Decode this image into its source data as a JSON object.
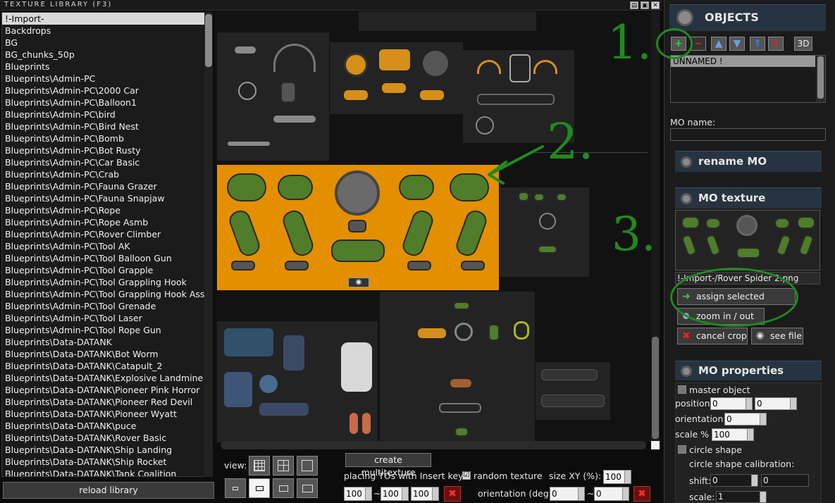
{
  "window": {
    "title": "TEXTURE LIBRARY (F3)"
  },
  "library": {
    "items": [
      "!-Import-",
      "Backdrops",
      "BG",
      "BG_chunks_50p",
      "Blueprints",
      "Blueprints\\Admin-PC",
      "Blueprints\\Admin-PC\\2000 Car",
      "Blueprints\\Admin-PC\\Balloon1",
      "Blueprints\\Admin-PC\\bird",
      "Blueprints\\Admin-PC\\Bird Nest",
      "Blueprints\\Admin-PC\\Bomb",
      "Blueprints\\Admin-PC\\Bot Rusty",
      "Blueprints\\Admin-PC\\Car Basic",
      "Blueprints\\Admin-PC\\Crab",
      "Blueprints\\Admin-PC\\Fauna Grazer",
      "Blueprints\\Admin-PC\\Fauna Snapjaw",
      "Blueprints\\Admin-PC\\Rope",
      "Blueprints\\Admin-PC\\Rope Asmb",
      "Blueprints\\Admin-PC\\Rover Climber",
      "Blueprints\\Admin-PC\\Tool AK",
      "Blueprints\\Admin-PC\\Tool Balloon Gun",
      "Blueprints\\Admin-PC\\Tool Grapple",
      "Blueprints\\Admin-PC\\Tool Grappling Hook",
      "Blueprints\\Admin-PC\\Tool Grappling Hook Assem",
      "Blueprints\\Admin-PC\\Tool Grenade",
      "Blueprints\\Admin-PC\\Tool Laser",
      "Blueprints\\Admin-PC\\Tool Rope Gun",
      "Blueprints\\Data-DATANK",
      "Blueprints\\Data-DATANK\\Bot Worm",
      "Blueprints\\Data-DATANK\\Catapult_2",
      "Blueprints\\Data-DATANK\\Explosive Landmine",
      "Blueprints\\Data-DATANK\\Pioneer Pink Horror",
      "Blueprints\\Data-DATANK\\Pioneer Red Devil",
      "Blueprints\\Data-DATANK\\Pioneer Wyatt",
      "Blueprints\\Data-DATANK\\puce",
      "Blueprints\\Data-DATANK\\Rover Basic",
      "Blueprints\\Data-DATANK\\Ship Landing",
      "Blueprints\\Data-DATANK\\Ship Rocket",
      "Blueprints\\Data-DATANK\\Tank Coalition"
    ],
    "reload_label": "reload library"
  },
  "toolbar": {
    "view_label": "view:",
    "create_multitexture": "create multitexture",
    "placing_label": "placing TOs with Insert key:",
    "random_texture_label": "random texture",
    "size_label": "size XY (%):",
    "size_value": "100",
    "scale_values": [
      "100",
      "100",
      "100"
    ],
    "tilde": "~",
    "orientation_label": "orientation (deg):",
    "orientation_values": [
      "0",
      "0"
    ],
    "random_texture_checked": "☑"
  },
  "objects": {
    "title": "OBJECTS",
    "btn_3d": "3D",
    "list": [
      "UNNAMED !"
    ],
    "mo_name_label": "MO name:",
    "mo_name_value": ""
  },
  "rename": {
    "title": "rename MO"
  },
  "mo_texture": {
    "title": "MO texture",
    "path": "!-Import-/Rover Spider 2.png",
    "assign_label": "assign selected texture",
    "zoom_label": "zoom in / out texture",
    "cancel_crop_label": "cancel crop",
    "see_file_label": "see file"
  },
  "mo_properties": {
    "title": "MO properties",
    "master_object_label": "master object",
    "position_label": "position",
    "position_values": [
      "0",
      "0"
    ],
    "orientation_label": "orientation °",
    "orientation_value": "0",
    "scale_label": "scale %",
    "scale_value": "100",
    "circle_shape_label": "circle shape",
    "circle_calib_label": "circle shape calibration:",
    "shift_label": "shift:",
    "shift_values": [
      "0",
      "0"
    ],
    "scale2_label": "scale:",
    "scale2_value": "1"
  },
  "annotations": {
    "a1": "1.",
    "a2": "2.",
    "a3": "3."
  },
  "colors": {
    "accent_green": "#1f8a1f",
    "selected_bg": "#e38f00",
    "header_bg": "#263340"
  }
}
